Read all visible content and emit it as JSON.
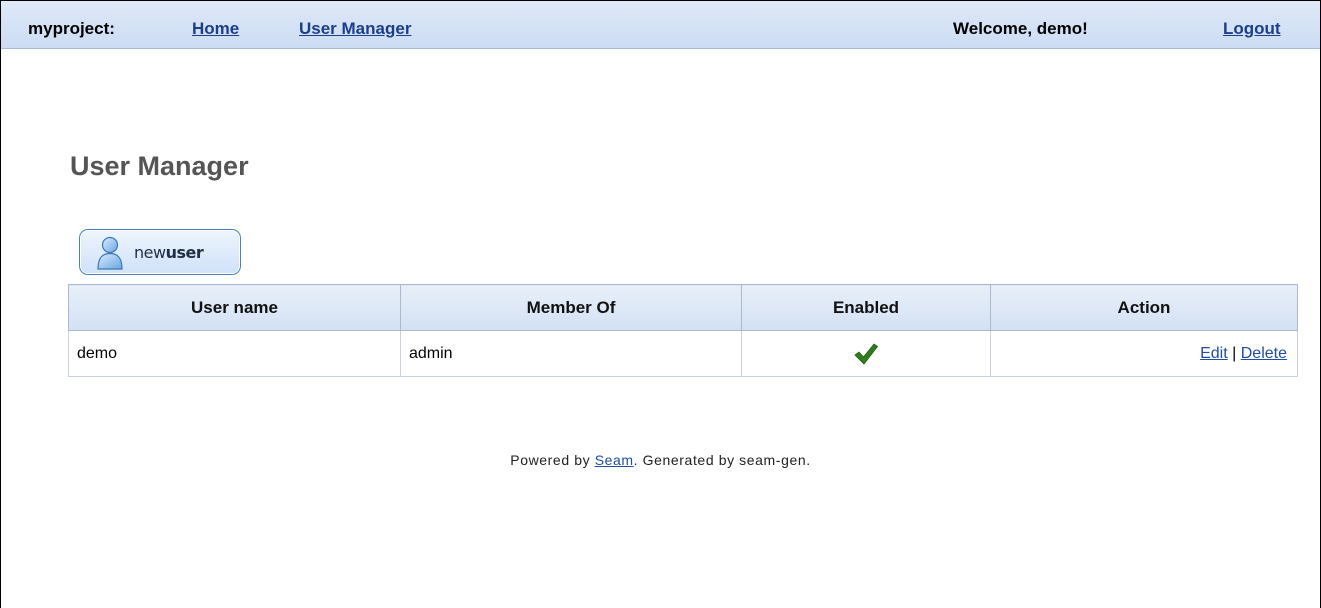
{
  "menu": {
    "brand": "myproject:",
    "home": "Home",
    "user_manager": "User Manager",
    "welcome": "Welcome, demo!",
    "logout": "Logout"
  },
  "page": {
    "title": "User Manager",
    "new_user_prefix": "new",
    "new_user_suffix": "user"
  },
  "table": {
    "headers": [
      "User name",
      "Member Of",
      "Enabled",
      "Action"
    ],
    "rows": [
      {
        "user_name": "demo",
        "member_of": "admin",
        "enabled_icon": "check-icon",
        "edit": "Edit",
        "separator": "|",
        "delete": "Delete"
      }
    ]
  },
  "footer": {
    "prefix": "Powered by",
    "link": "Seam",
    "suffix": ". Generated by seam-gen."
  },
  "colors": {
    "menu_bg": "#d6e3f6",
    "link": "#1c3f8a",
    "title": "#555555",
    "check": "#2e7d1e"
  }
}
